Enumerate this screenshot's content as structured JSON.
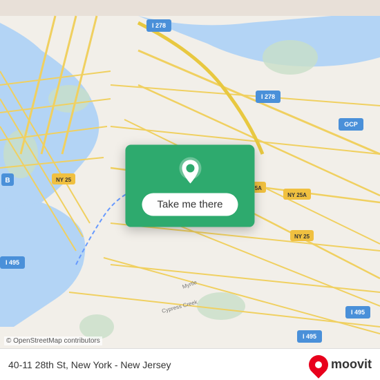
{
  "map": {
    "attribution": "© OpenStreetMap contributors",
    "background_color": "#e8e0d8"
  },
  "card": {
    "button_label": "Take me there",
    "background_color": "#2eaa6e"
  },
  "bottom_bar": {
    "address": "40-11 28th St, New York - New Jersey",
    "logo_text": "moovit"
  }
}
